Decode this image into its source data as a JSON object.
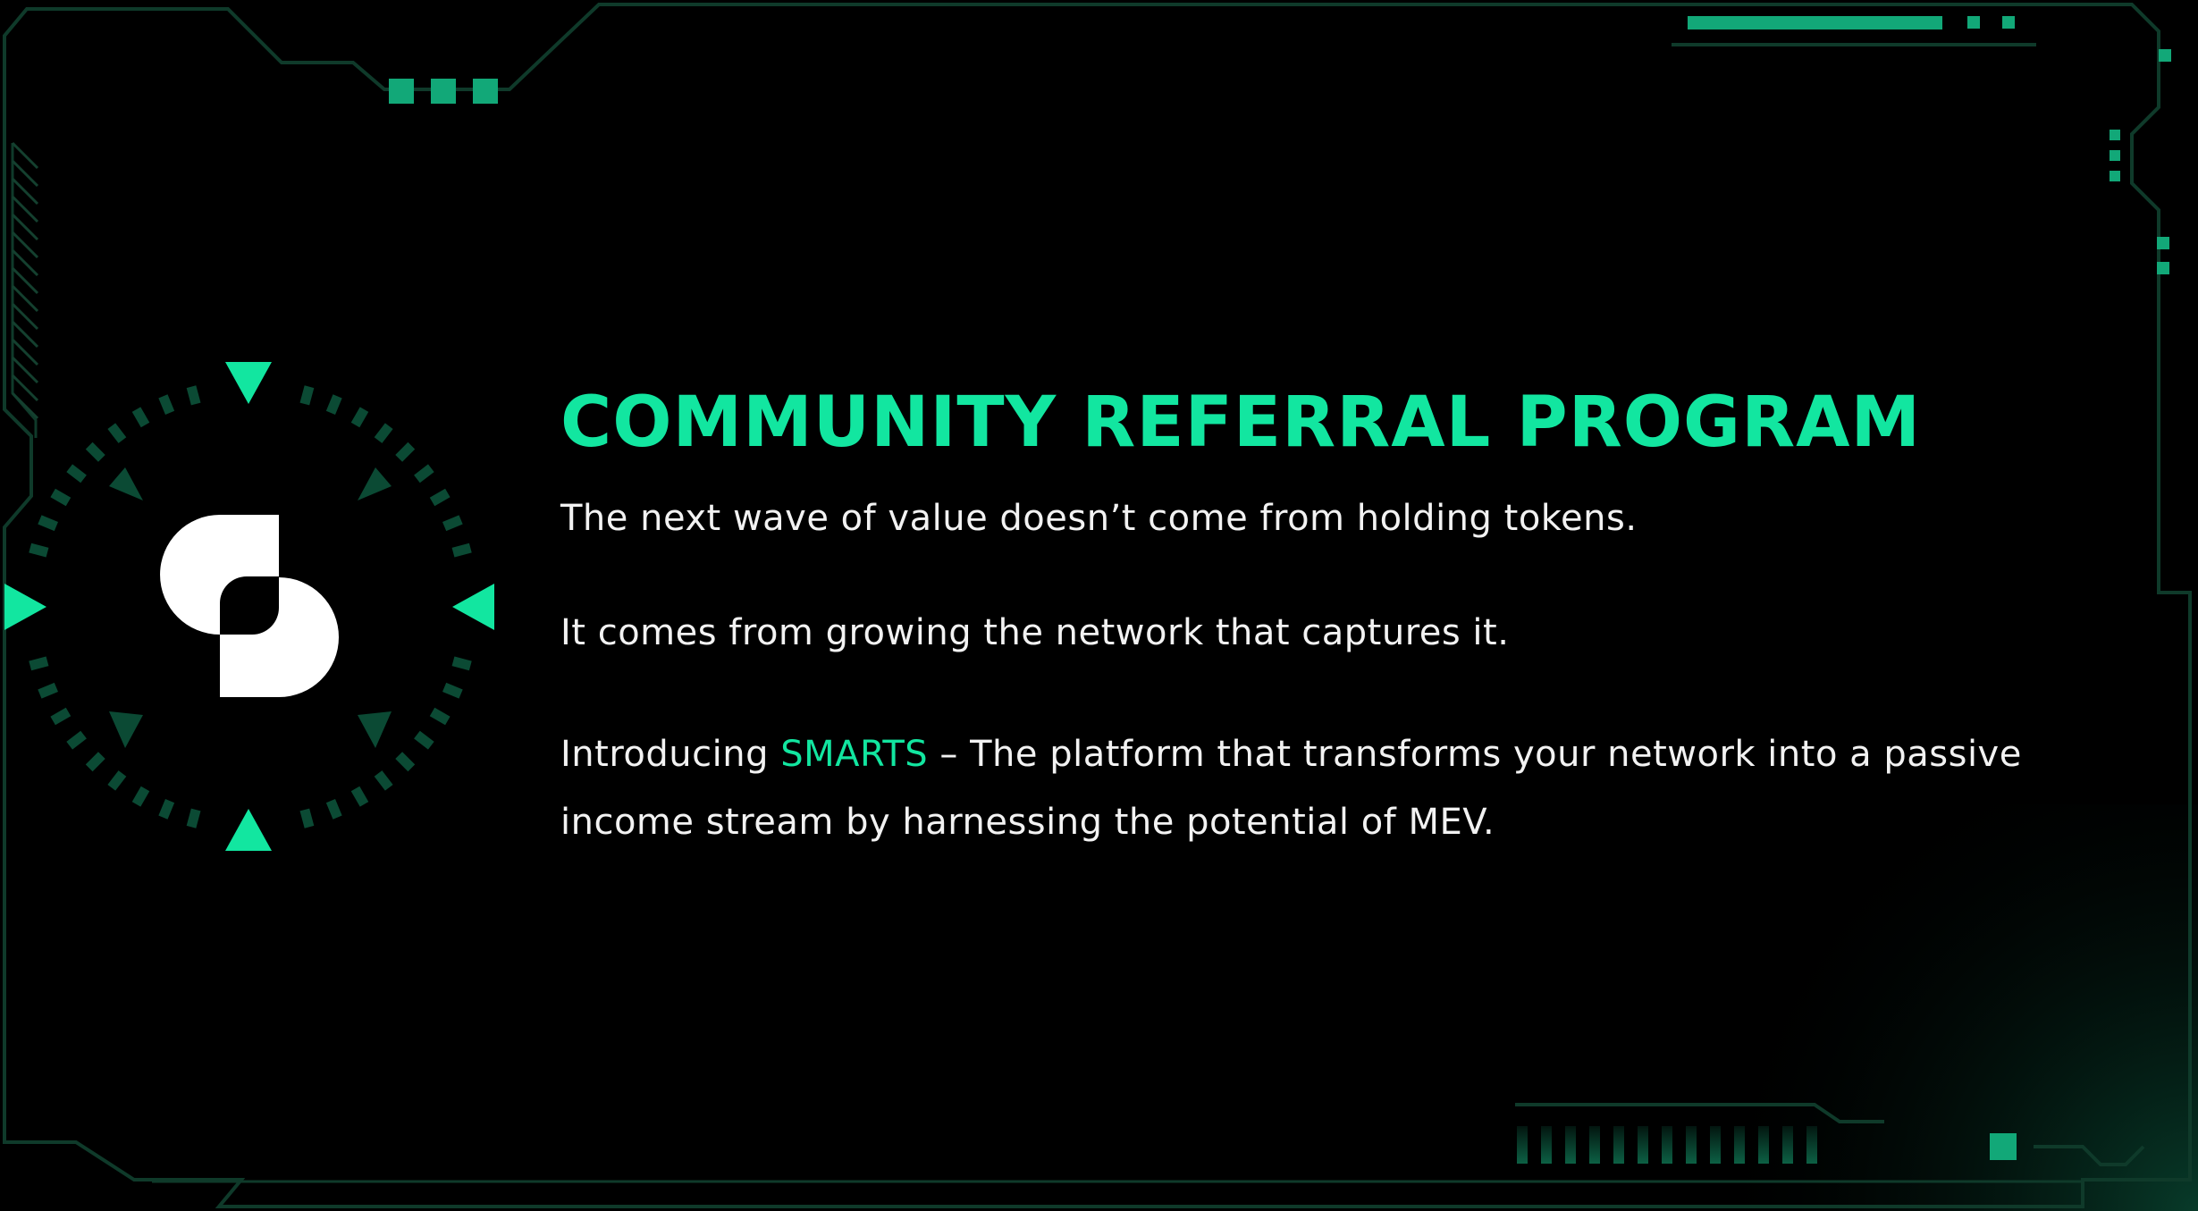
{
  "slide": {
    "title": "COMMUNITY REFERRAL PROGRAM",
    "paragraphs": {
      "p1": "The next wave of value doesn’t come from holding tokens.",
      "p2": "It comes from growing the network that captures it.",
      "p3_intro": "Introducing ",
      "p3_brand": "SMARTS",
      "p3_rest": " – The platform that transforms your network into a passive income stream by harnessing the potential of MEV."
    }
  },
  "logo": {
    "icon": "smarts-s-logo-icon",
    "dial_icon": "radial-dial-icon"
  },
  "colors": {
    "background": "#000000",
    "accent": "#12E6A0",
    "accent_dim": "#0B4A34",
    "frame_line": "#0F3A2A",
    "text": "#F2F2F2"
  }
}
